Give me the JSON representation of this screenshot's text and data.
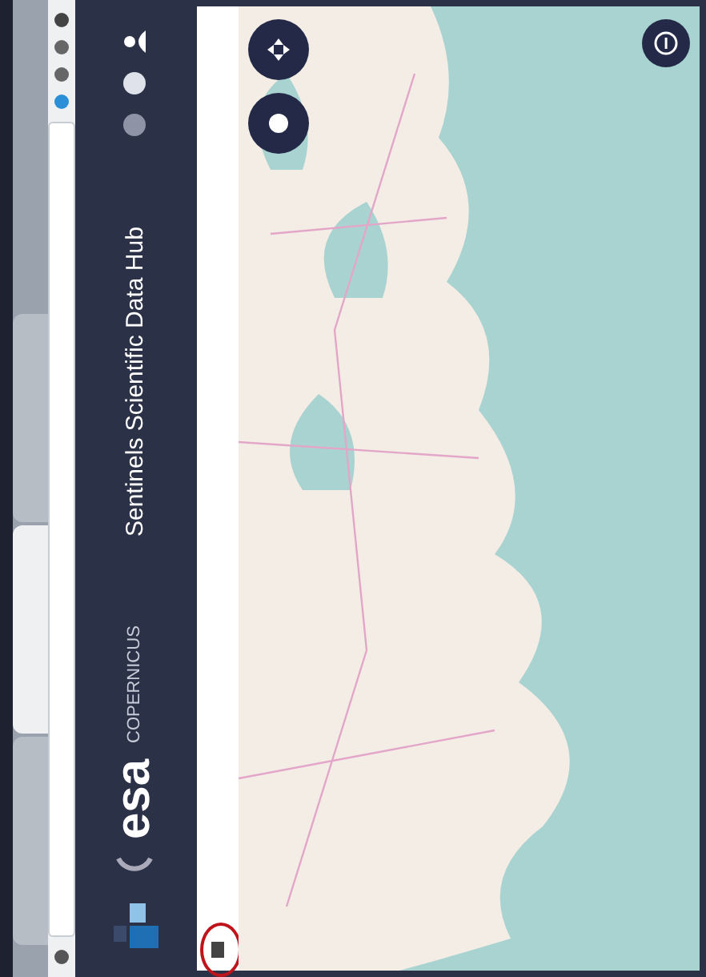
{
  "browser": {
    "tabs": [
      {
        "selected": false
      },
      {
        "selected": true
      },
      {
        "selected": false
      }
    ]
  },
  "header": {
    "logo_text": "esa",
    "program": "COPERNICUS",
    "title": "Sentinels Scientific Data Hub"
  },
  "map": {
    "highlight": true
  }
}
